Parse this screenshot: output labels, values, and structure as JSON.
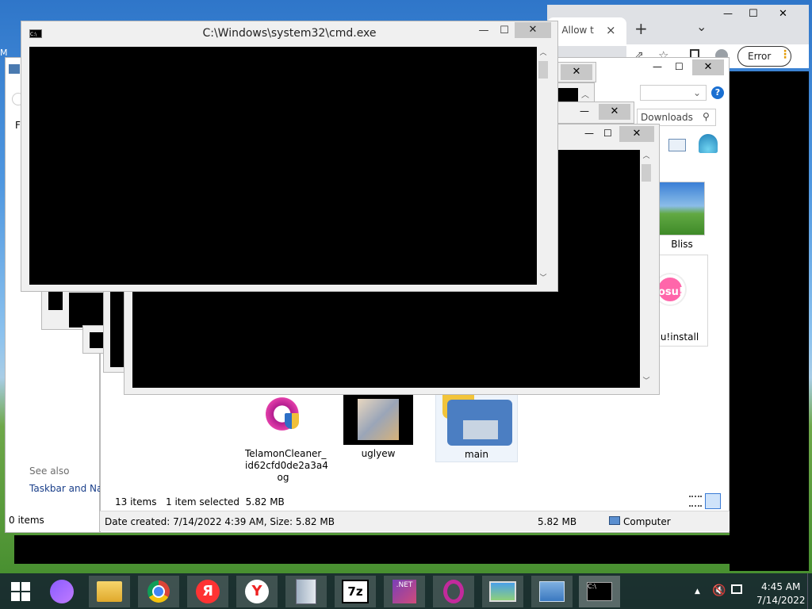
{
  "desktop": {
    "left_label": "M"
  },
  "chrome": {
    "tab_label": "ss Allow t",
    "tab_close": "×",
    "new_tab": "+",
    "tab_menu": "⌄",
    "window_min": "—",
    "window_max": "☐",
    "window_close": "✕",
    "error_label": "Error"
  },
  "cmd_main": {
    "title": "C:\\Windows\\system32\\cmd.exe",
    "min": "—",
    "max": "☐",
    "close": "✕"
  },
  "stack_windows": {
    "min": "—",
    "max": "☐",
    "close": "✕"
  },
  "explorer": {
    "search_placeholder": "Downloads",
    "help": "?",
    "files": [
      {
        "name": "Bliss"
      },
      {
        "name": "osu!install"
      },
      {
        "name": "TelamonCleaner_id62cfd0de2a3a4og"
      },
      {
        "name": "uglyew"
      },
      {
        "name": "main"
      }
    ],
    "caption_lines": {
      "bliss": "Bliss",
      "osu": "u!install",
      "telamon_1": "TelamonCleaner_",
      "telamon_2": "id62cfd0de2a3a4",
      "telamon_3": "og",
      "uglyew": "uglyew",
      "main": "main"
    },
    "status": {
      "items": "13 items",
      "selected": "1 item selected  5.82 MB"
    },
    "details": "Date created: 7/14/2022 4:39 AM, Size: 5.82 MB",
    "size": "5.82 MB",
    "computer": "Computer"
  },
  "left_panel": {
    "menu": "Fi",
    "see_also": "See also",
    "taskbar_link": "Taskbar and Nav",
    "items": "0 items"
  },
  "taskbar": {
    "apps": [
      "start",
      "alice",
      "file-explorer",
      "chrome",
      "yandex",
      "yandex-browser",
      "archiver",
      "7zip",
      "dotnet",
      "opera",
      "photo",
      "control-panel",
      "cmd"
    ],
    "seven_zip_label": "7z",
    "yandex_label": "Я",
    "yandex_browser_label": "Y",
    "net_label": ".NET",
    "cmd_label": "C:\\",
    "clock": {
      "time": "4:45 AM",
      "date": "7/14/2022"
    },
    "tray_up": "▲"
  },
  "colors": {
    "taskbar": "#1c2a44",
    "cmd_bg": "#000000",
    "window_frame": "#f0f0f0"
  }
}
